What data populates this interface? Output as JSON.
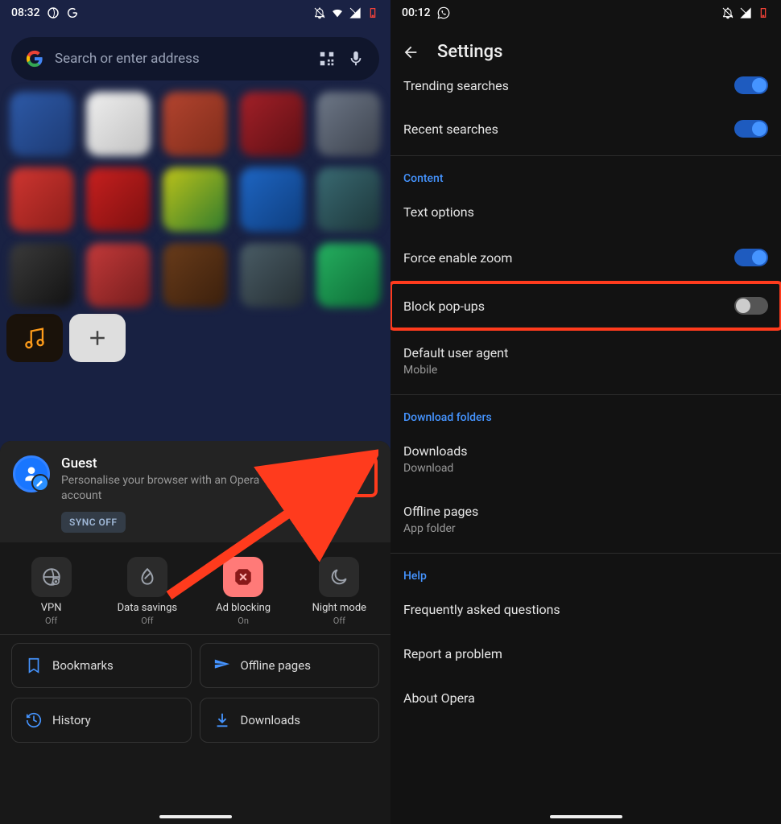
{
  "left": {
    "status": {
      "time": "08:32"
    },
    "search": {
      "placeholder": "Search or enter address"
    },
    "tiles": [
      {
        "bg": "linear-gradient(135deg,#2d5aa8,#1d3a73)"
      },
      {
        "bg": "linear-gradient(135deg,#efefef,#c0c0c0)"
      },
      {
        "bg": "linear-gradient(135deg,#b4442f,#7e2c1a)"
      },
      {
        "bg": "linear-gradient(135deg,#a42028,#5c0f14)"
      },
      {
        "bg": "linear-gradient(135deg,#6e7888,#3c424d)"
      },
      {
        "bg": "linear-gradient(135deg,#d03631,#8b1d19)"
      },
      {
        "bg": "linear-gradient(135deg,#c9201f,#7a0f0f)"
      },
      {
        "bg": "linear-gradient(135deg,#c0c419,#2e7a2e)"
      },
      {
        "bg": "linear-gradient(135deg,#1e66c4,#0e3d7d)"
      },
      {
        "bg": "linear-gradient(135deg,#3a6b73,#1c3539)"
      },
      {
        "bg": "linear-gradient(135deg,#3b3b3b,#111)"
      },
      {
        "bg": "linear-gradient(135deg,#c43a3a,#731c1c)"
      },
      {
        "bg": "linear-gradient(135deg,#6a3c1a,#3a1f0c)"
      },
      {
        "bg": "linear-gradient(135deg,#4a5d66,#252e33)"
      },
      {
        "bg": "linear-gradient(135deg,#25b060,#0d6a35)"
      }
    ],
    "account": {
      "title": "Guest",
      "subtitle": "Personalise your browser with an Opera account",
      "sync": "SYNC OFF"
    },
    "quick": [
      {
        "label": "VPN",
        "status": "Off"
      },
      {
        "label": "Data savings",
        "status": "Off"
      },
      {
        "label": "Ad blocking",
        "status": "On"
      },
      {
        "label": "Night mode",
        "status": "Off"
      }
    ],
    "chips": {
      "bookmarks": "Bookmarks",
      "offline": "Offline pages",
      "history": "History",
      "downloads": "Downloads"
    }
  },
  "right": {
    "status": {
      "time": "00:12"
    },
    "title": "Settings",
    "rows": {
      "trending": "Trending searches",
      "recent": "Recent searches",
      "section_content": "Content",
      "text_options": "Text options",
      "force_zoom": "Force enable zoom",
      "block_popups": "Block pop-ups",
      "default_ua": "Default user agent",
      "default_ua_sub": "Mobile",
      "section_downloads": "Download folders",
      "downloads": "Downloads",
      "downloads_sub": "Download",
      "offline_pages": "Offline pages",
      "offline_pages_sub": "App folder",
      "section_help": "Help",
      "faq": "Frequently asked questions",
      "report": "Report a problem",
      "about": "About Opera"
    }
  }
}
